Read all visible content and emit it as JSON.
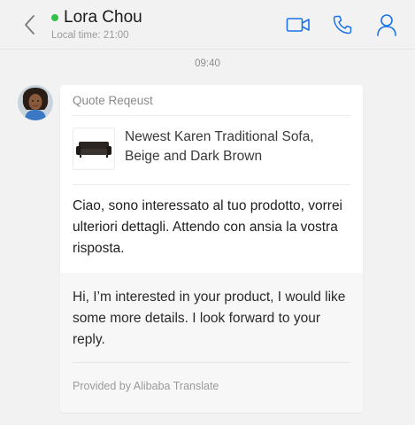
{
  "header": {
    "contact_name": "Lora Chou",
    "local_time": "Local time: 21:00",
    "status_color": "#35c04a",
    "icons": [
      "back-chevron-icon",
      "video-call-icon",
      "phone-call-icon",
      "profile-icon"
    ],
    "accent_color": "#1a73e8"
  },
  "chat": {
    "time_separator": "09:40",
    "message": {
      "card_title": "Quote Reqeust",
      "product_title": "Newest Karen Traditional Sofa, Beige and Dark Brown",
      "original_text": "Ciao, sono interessato al tuo prodotto, vorrei ulteriori dettagli. Attendo con ansia la vostra risposta.",
      "translated_text": "Hi, I’m interested in your product, I would like some more details. I look forward to your reply.",
      "translation_credit": "Provided by Alibaba Translate"
    }
  }
}
